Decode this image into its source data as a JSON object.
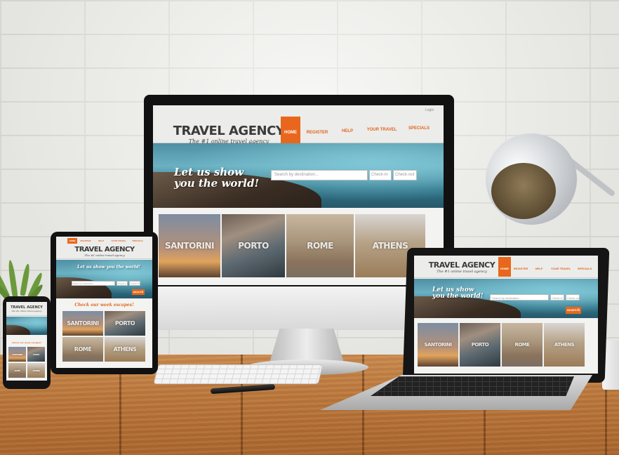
{
  "site": {
    "brand_title": "TRAVEL AGENCY",
    "brand_tagline": "The #1 online travel agency",
    "login_label": "Login",
    "nav": [
      "HOME",
      "REGISTER",
      "HELP",
      "YOUR TRAVEL",
      "SPECIALS"
    ],
    "hero_slogan_line1": "Let us show",
    "hero_slogan_line2": "you the world!",
    "search_placeholder": "Search by destination...",
    "checkin_label": "Check-in",
    "checkout_label": "Check-out",
    "search_button": "search",
    "subheading": "Check our week escapes!",
    "destinations": [
      "SANTORINI",
      "PORTO",
      "ROME",
      "ATHENS"
    ]
  },
  "colors": {
    "accent": "#e8671c",
    "header_bg": "#ececea",
    "text_dark": "#3a3a3a"
  }
}
